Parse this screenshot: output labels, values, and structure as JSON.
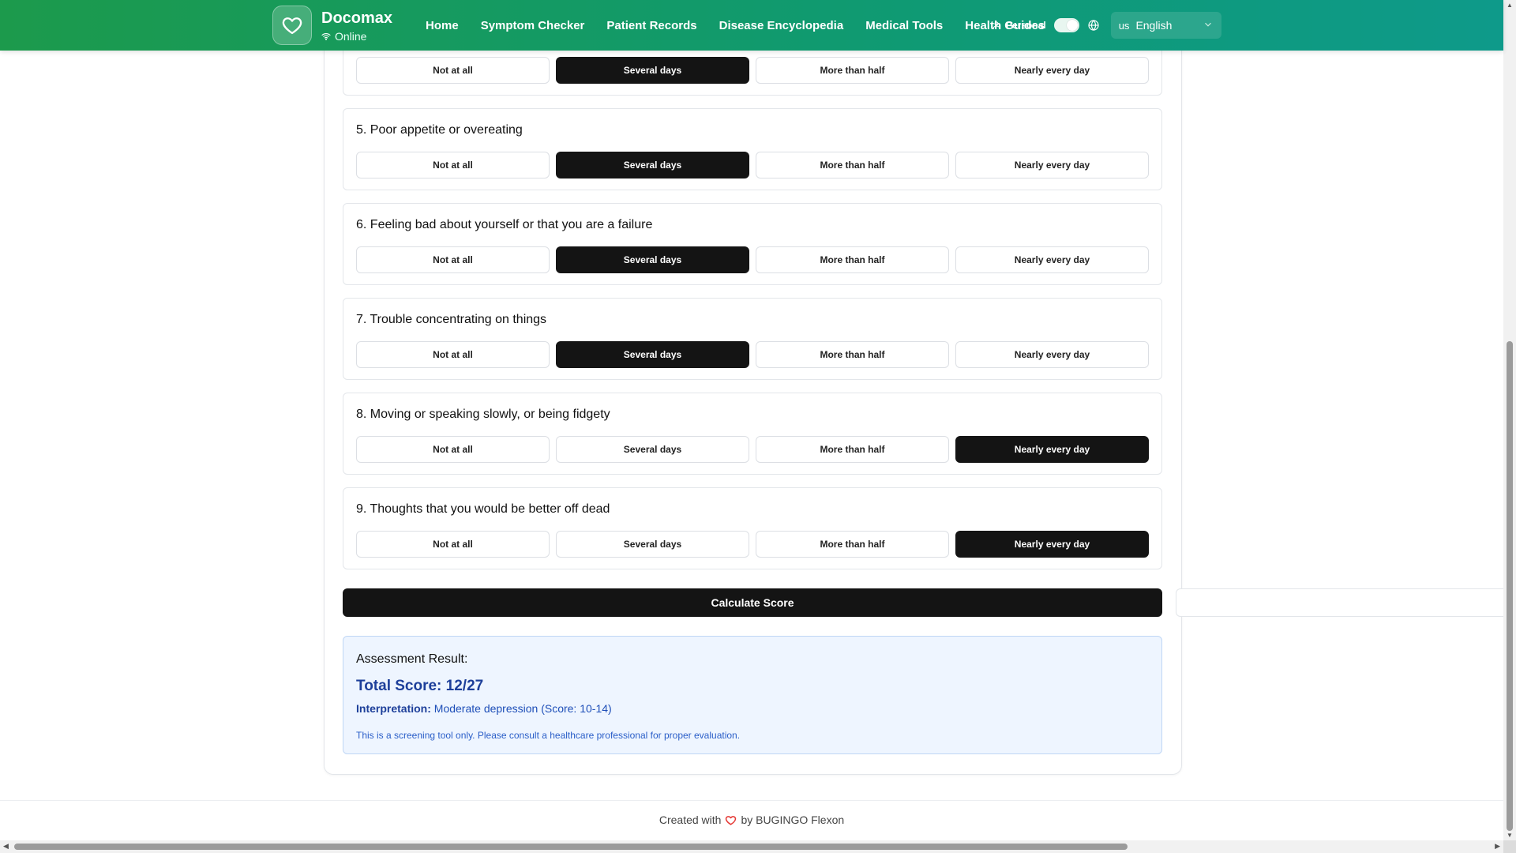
{
  "header": {
    "brand_name": "Docomax",
    "status": "Online",
    "nav": [
      "Home",
      "Symptom Checker",
      "Patient Records",
      "Disease Encyclopedia",
      "Medical Tools",
      "Health Guides"
    ],
    "mode_label": "Personal",
    "language": {
      "flag": "us",
      "label": "English"
    },
    "colors": {
      "gradient_start": "#1c9a4c",
      "gradient_end": "#0e9a8a"
    }
  },
  "options": [
    "Not at all",
    "Several days",
    "More than half",
    "Nearly every day"
  ],
  "questions": [
    {
      "title": "",
      "selected": 1
    },
    {
      "title": "5. Poor appetite or overeating",
      "selected": 1
    },
    {
      "title": "6. Feeling bad about yourself or that you are a failure",
      "selected": 1
    },
    {
      "title": "7. Trouble concentrating on things",
      "selected": 1
    },
    {
      "title": "8. Moving or speaking slowly, or being fidgety",
      "selected": 3
    },
    {
      "title": "9. Thoughts that you would be better off dead",
      "selected": 3
    }
  ],
  "calculate_label": "Calculate Score",
  "result": {
    "heading": "Assessment Result:",
    "score": "Total Score: 12/27",
    "interpretation_label": "Interpretation:",
    "interpretation": "Moderate depression (Score: 10-14)",
    "note": "This is a screening tool only. Please consult a healthcare professional for proper evaluation."
  },
  "footer": {
    "prefix": "Created with",
    "suffix": "by BUGINGO Flexon"
  },
  "icons": {
    "logo": "heart-icon",
    "status": "wifi-icon",
    "mode": "user-icon",
    "language": "globe-icon",
    "footer": "heart-icon"
  }
}
